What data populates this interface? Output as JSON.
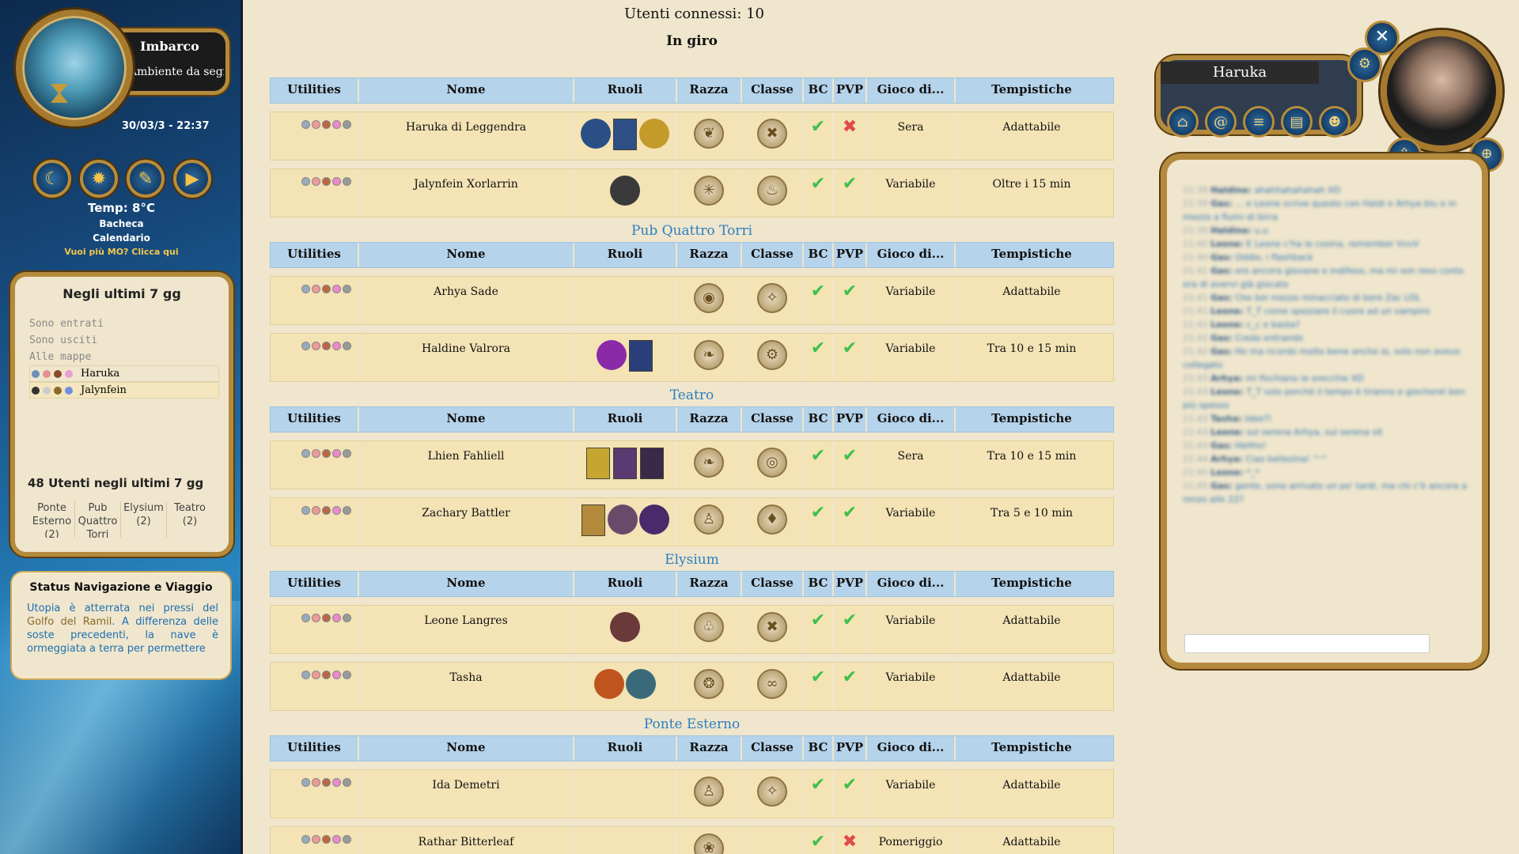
{
  "sidebar": {
    "location_title": "Imbarco",
    "location_sub": "Ambiente da segnalare",
    "datetime": "30/03/3 - 22:37",
    "temp": "Temp: 8°C",
    "bacheca": "Bacheca",
    "calendario": "Calendario",
    "mo_link": "Vuoi più MO? Clicca qui",
    "panel_title": "Negli ultimi 7 gg",
    "lines": [
      "Sono entrati",
      "Sono usciti",
      "Alle mappe"
    ],
    "users": [
      "Haruka",
      "Jalynfein"
    ],
    "count": "48 Utenti negli ultimi 7 gg",
    "rooms": [
      "Ponte Esterno (2)",
      "Pub Quattro Torri",
      "Elysium (2)",
      "Teatro (2)"
    ],
    "status_title": "Status Navigazione e Viaggio",
    "status_text_1": "Utopia è atterrata nei pressi del ",
    "status_place": "Golfo del Ramil",
    "status_text_2": ". A differenza delle soste precedenti, la nave è ormeggiata a terra per permettere"
  },
  "main": {
    "connessi": "Utenti connessi: 10",
    "headers": [
      "Utilities",
      "Nome",
      "Ruoli",
      "Razza",
      "Classe",
      "BC",
      "PVP",
      "Gioco di...",
      "Tempistiche"
    ],
    "sections": [
      {
        "title": "In giro",
        "rows": [
          {
            "nome": "Haruka di Leggendra",
            "pvp": false,
            "gioco": "Sera",
            "tempi": "Adattabile"
          },
          {
            "nome": "Jalynfein Xorlarrin",
            "pvp": true,
            "gioco": "Variabile",
            "tempi": "Oltre i 15 min"
          }
        ]
      },
      {
        "title": "Pub Quattro Torri",
        "rows": [
          {
            "nome": "Arhya Sade",
            "pvp": true,
            "gioco": "Variabile",
            "tempi": "Adattabile"
          },
          {
            "nome": "Haldine Valrora",
            "pvp": true,
            "gioco": "Variabile",
            "tempi": "Tra 10 e 15 min"
          }
        ]
      },
      {
        "title": "Teatro",
        "rows": [
          {
            "nome": "Lhien Fahliell",
            "pvp": true,
            "gioco": "Sera",
            "tempi": "Tra 10 e 15 min"
          },
          {
            "nome": "Zachary Battler",
            "pvp": true,
            "gioco": "Variabile",
            "tempi": "Tra 5 e 10 min"
          }
        ]
      },
      {
        "title": "Elysium",
        "rows": [
          {
            "nome": "Leone Langres",
            "pvp": true,
            "gioco": "Variabile",
            "tempi": "Adattabile"
          },
          {
            "nome": "Tasha",
            "pvp": true,
            "gioco": "Variabile",
            "tempi": "Adattabile"
          }
        ]
      },
      {
        "title": "Ponte Esterno",
        "rows": [
          {
            "nome": "Ida Demetri",
            "pvp": true,
            "gioco": "Variabile",
            "tempi": "Adattabile"
          },
          {
            "nome": "Rathar Bitterleaf",
            "pvp": false,
            "gioco": "Pomeriggio",
            "tempi": "Adattabile"
          }
        ]
      }
    ]
  },
  "chat": {
    "title": "Haruka",
    "messages": [
      {
        "t": "21:39",
        "who": "Haldine:",
        "msg": "ahahhahahahah XD"
      },
      {
        "t": "21:39",
        "who": "Gas:",
        "msg": "... e Leone scrive questo con Haldi e Arhya blu e in mezzo a fiumi di birra"
      },
      {
        "t": "21:39",
        "who": "Haldine:",
        "msg": "u.u"
      },
      {
        "t": "21:40",
        "who": "Leone:",
        "msg": "E Leone c'ha la cosina, remember VvvV"
      },
      {
        "t": "21:40",
        "who": "Gas:",
        "msg": "Oddio, i flashback"
      },
      {
        "t": "21:41",
        "who": "Gas:",
        "msg": "ero ancora giovane e indifeso, ma mi son reso conto ora di avervi già giocato"
      },
      {
        "t": "21:41",
        "who": "Gas:",
        "msg": "Che bei mezzo minacciato di bere Zac LOL"
      },
      {
        "t": "21:41",
        "who": "Leone:",
        "msg": "T_T come spezzare il cuore ad un vampiro"
      },
      {
        "t": "21:42",
        "who": "Leone:",
        "msg": "c_c e basta?"
      },
      {
        "t": "21:42",
        "who": "Gas:",
        "msg": "Credo entrambi"
      },
      {
        "t": "21:42",
        "who": "Gas:",
        "msg": "Ho ma ricordo molto bene anche io, solo non avevo collegato"
      },
      {
        "t": "21:43",
        "who": "Arhya:",
        "msg": "mi fischiano le orecchie XD"
      },
      {
        "t": "21:43",
        "who": "Leone:",
        "msg": "T_T solo perchè il tempo è tiranno e giochereì ben più spesso"
      },
      {
        "t": "21:43",
        "who": "Tasha:",
        "msg": "Idee?!"
      },
      {
        "t": "21:43",
        "who": "Leone:",
        "msg": "sul serena Arhya, sul serena sit"
      },
      {
        "t": "21:43",
        "who": "Gas:",
        "msg": "Hellho!"
      },
      {
        "t": "21:44",
        "who": "Arhya:",
        "msg": "Ciao bellezina! ^^"
      },
      {
        "t": "21:45",
        "who": "Leone:",
        "msg": "*_*"
      },
      {
        "t": "21:45",
        "who": "Gas:",
        "msg": "gente, sono arrivato un po' tardi, ma chi c'è ancora a ronzo alle 22?"
      }
    ]
  },
  "colors": {
    "accent": "#2c7fc0",
    "header_bg": "#b5d3ea",
    "row_bg": "#f3e3b5",
    "gold": "#b48a3c"
  }
}
